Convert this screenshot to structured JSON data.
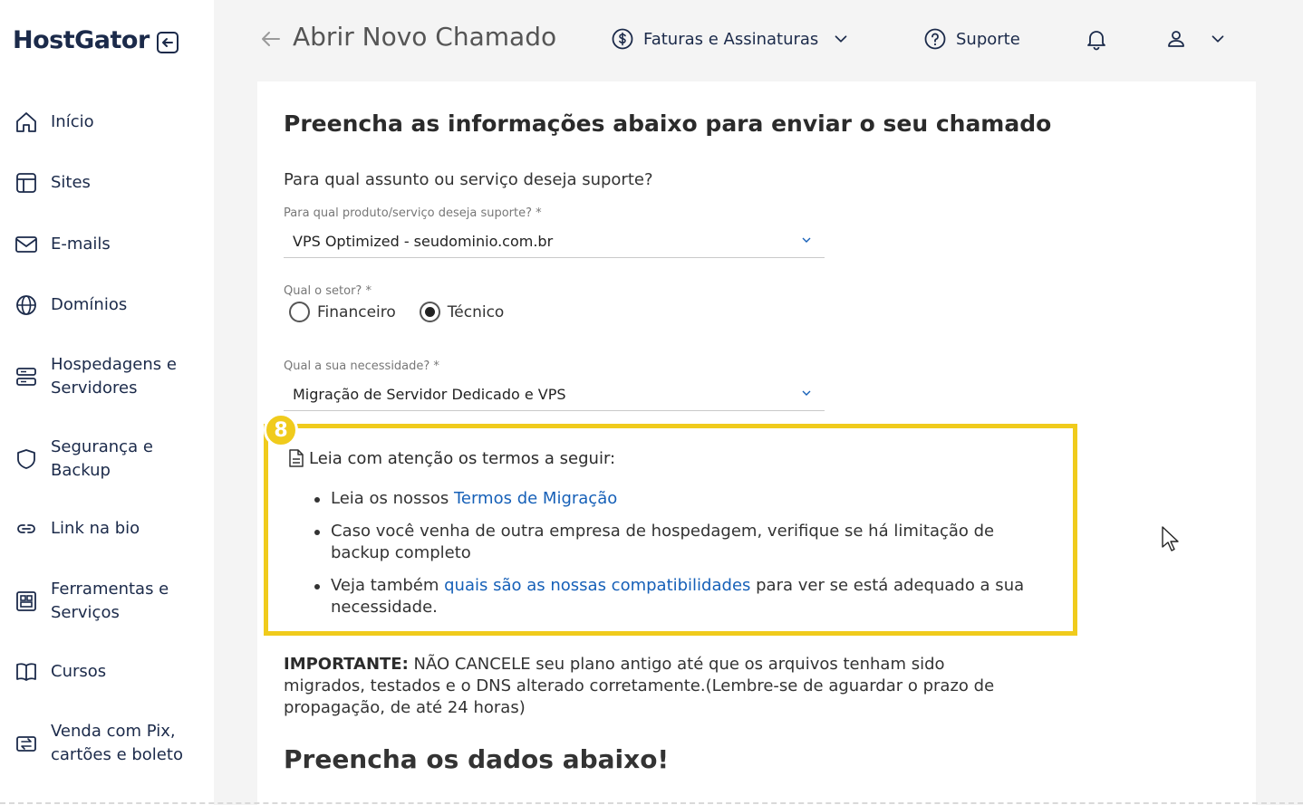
{
  "sidebar": {
    "logo": "HostGator",
    "items": [
      {
        "label": "Início"
      },
      {
        "label": "Sites"
      },
      {
        "label": "E-mails"
      },
      {
        "label": "Domínios"
      },
      {
        "label": "Hospedagens e Servidores"
      },
      {
        "label": "Segurança e Backup"
      },
      {
        "label": "Link na bio"
      },
      {
        "label": "Ferramentas e Serviços"
      },
      {
        "label": "Cursos"
      },
      {
        "label": "Venda com Pix, cartões e boleto"
      }
    ]
  },
  "header": {
    "title": "Abrir Novo Chamado",
    "billing": "Faturas e Assinaturas",
    "support": "Suporte"
  },
  "form": {
    "title": "Preencha as informações abaixo para enviar o seu chamado",
    "question": "Para qual assunto ou serviço deseja suporte?",
    "product_label": "Para qual produto/serviço deseja suporte? *",
    "product_value": "VPS Optimized - seudominio.com.br",
    "sector_label": "Qual o setor? *",
    "sector_options": [
      "Financeiro",
      "Técnico"
    ],
    "need_label": "Qual a sua necessidade? *",
    "need_value": "Migração de Servidor Dedicado e VPS"
  },
  "terms": {
    "badge": "8",
    "title": "Leia com atenção os termos a seguir:",
    "item1_prefix": "Leia os nossos ",
    "item1_link": "Termos de Migração",
    "item2": "Caso você venha de outra empresa de hospedagem, verifique se há limitação de backup completo",
    "item3_prefix": "Veja também ",
    "item3_link": "quais são as nossas compatibilidades",
    "item3_suffix": " para ver se está adequado a sua necessidade."
  },
  "important": {
    "label": "IMPORTANTE:",
    "text": " NÃO CANCELE seu plano antigo até que os arquivos tenham sido migrados, testados e o DNS alterado corretamente.(Lembre-se de aguardar o prazo de propagação, de até 24 horas)"
  },
  "fill_title": "Preencha os dados abaixo!",
  "colors": {
    "highlight": "#f0cb1c",
    "link": "#1660b8",
    "brand_text": "#1b2a4a"
  }
}
